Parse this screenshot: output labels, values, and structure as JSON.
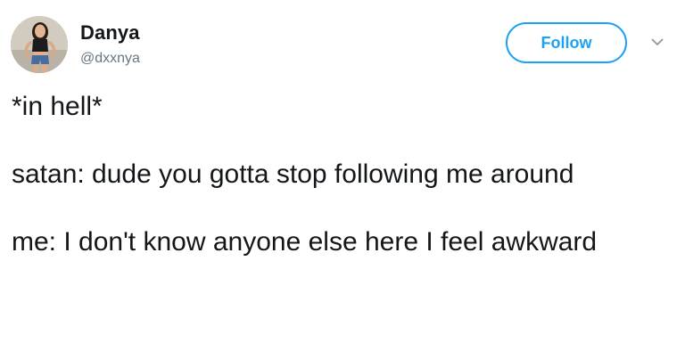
{
  "tweet": {
    "author": {
      "display_name": "Danya",
      "handle": "@dxxnya"
    },
    "follow_label": "Follow",
    "text_lines": [
      "*in hell*",
      "satan: dude you gotta stop following me around",
      "me: I don't know anyone else here I feel awkward"
    ]
  },
  "icons": {
    "avatar": "profile-photo",
    "menu": "chevron-down-icon"
  },
  "colors": {
    "accent": "#1da1f2",
    "text_primary": "#14171a",
    "text_secondary": "#657786",
    "background": "#ffffff"
  }
}
